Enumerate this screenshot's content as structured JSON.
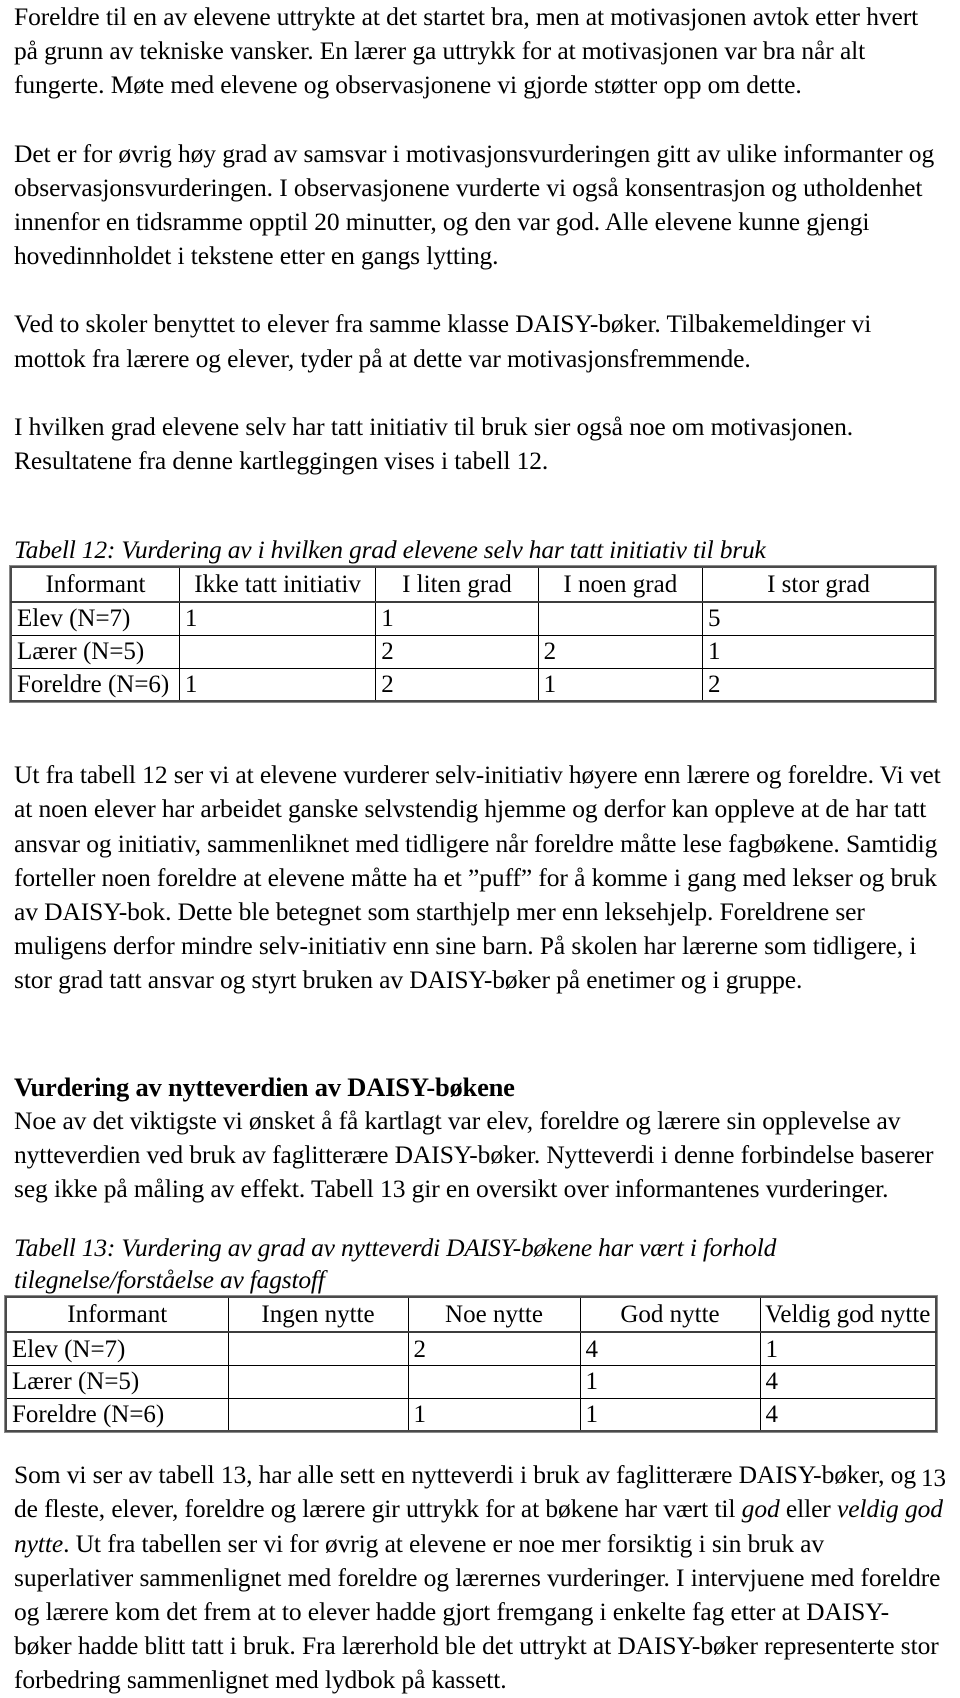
{
  "document": {
    "page_number": "13",
    "paragraphs": {
      "p1": "Foreldre til en av elevene uttrykte at det startet bra, men at motivasjonen avtok etter hvert på grunn av tekniske vansker. En lærer ga uttrykk for at motivasjonen var bra når alt fungerte. Møte med elevene og observasjonene vi gjorde støtter opp om dette.",
      "p2": "Det er for øvrig høy grad av samsvar i motivasjonsvurderingen gitt av ulike informanter og observasjonsvurderingen. I observasjonene vurderte vi også konsentrasjon og utholdenhet innenfor en tidsramme opptil 20 minutter, og den var god. Alle elevene kunne gjengi hovedinnholdet i tekstene etter en gangs lytting.",
      "p3": "Ved to skoler benyttet to elever fra samme klasse DAISY-bøker. Tilbakemeldinger vi mottok fra lærere og elever, tyder på at dette var motivasjonsfremmende.",
      "p4": "I hvilken grad elevene selv har tatt initiativ til bruk sier også noe om motivasjonen. Resultatene fra denne kartleggingen vises i tabell 12.",
      "p5": "Ut fra tabell 12 ser vi at elevene vurderer selv-initiativ høyere enn lærere og foreldre. Vi vet at noen elever har arbeidet ganske selvstendig hjemme og derfor kan oppleve at de har tatt ansvar og initiativ, sammenliknet med tidligere når foreldre måtte lese fagbøkene. Samtidig forteller noen foreldre at elevene måtte ha et ”puff” for å komme i gang med lekser og bruk av DAISY-bok. Dette ble betegnet som starthjelp mer enn leksehjelp. Foreldrene ser muligens derfor mindre selv-initiativ enn sine barn. På skolen har lærerne som tidligere, i stor grad tatt ansvar og styrt bruken av DAISY-bøker på enetimer og i gruppe.",
      "p6": "Noe av det viktigste vi ønsket å få kartlagt var elev, foreldre og lærere sin opplevelse av nytteverdien ved bruk av faglitterære DAISY-bøker. Nytteverdi i denne forbindelse baserer seg ikke på måling av effekt. Tabell 13 gir en oversikt over informantenes vurderinger.",
      "p7_part1": "Som vi ser av tabell 13, har alle sett en nytteverdi i bruk av faglitterære DAISY-bøker, og de fleste, elever, foreldre og lærere gir uttrykk for at bøkene har vært til ",
      "p7_em1": "god",
      "p7_part2": " eller ",
      "p7_em2": "veldig god nytte",
      "p7_part3": ". Ut fra tabellen ser vi for øvrig at elevene er noe mer forsiktig i sin bruk av superlativer sammenlignet med foreldre og lærernes vurderinger. I intervjuene med foreldre og lærere kom det frem at to elever hadde gjort fremgang i enkelte fag etter at DAISY-bøker hadde blitt tatt i bruk. Fra lærerhold ble det uttrykt at DAISY-bøker representerte stor forbedring sammenlignet med lydbok på kassett."
    },
    "heading": "Vurdering av nytteverdien av DAISY-bøkene",
    "table_12": {
      "caption": "Tabell 12: Vurdering av i hvilken grad elevene selv har tatt initiativ til bruk",
      "headers": [
        "Informant",
        "Ikke tatt initiativ",
        "I liten grad",
        "I noen grad",
        "I stor grad"
      ],
      "rows": [
        {
          "label": "Elev (N=7)",
          "values": [
            "1",
            "1",
            "",
            "5"
          ]
        },
        {
          "label": "Lærer (N=5)",
          "values": [
            "",
            "2",
            "2",
            "1"
          ]
        },
        {
          "label": "Foreldre (N=6)",
          "values": [
            "1",
            "2",
            "1",
            "2"
          ]
        }
      ]
    },
    "table_13": {
      "caption_line1": "Tabell 13: Vurdering av grad av nytteverdi DAISY-bøkene har vært i forhold",
      "caption_line2": "tilegnelse/forståelse av fagstoff",
      "headers": [
        "Informant",
        "Ingen nytte",
        "Noe nytte",
        "God nytte",
        "Veldig god nytte"
      ],
      "rows": [
        {
          "label": "Elev  (N=7)",
          "values": [
            "",
            "2",
            "4",
            "1"
          ]
        },
        {
          "label": "Lærer (N=5)",
          "values": [
            "",
            "",
            "1",
            "4"
          ]
        },
        {
          "label": "Foreldre (N=6)",
          "values": [
            "",
            "1",
            "1",
            "4"
          ]
        }
      ]
    }
  }
}
